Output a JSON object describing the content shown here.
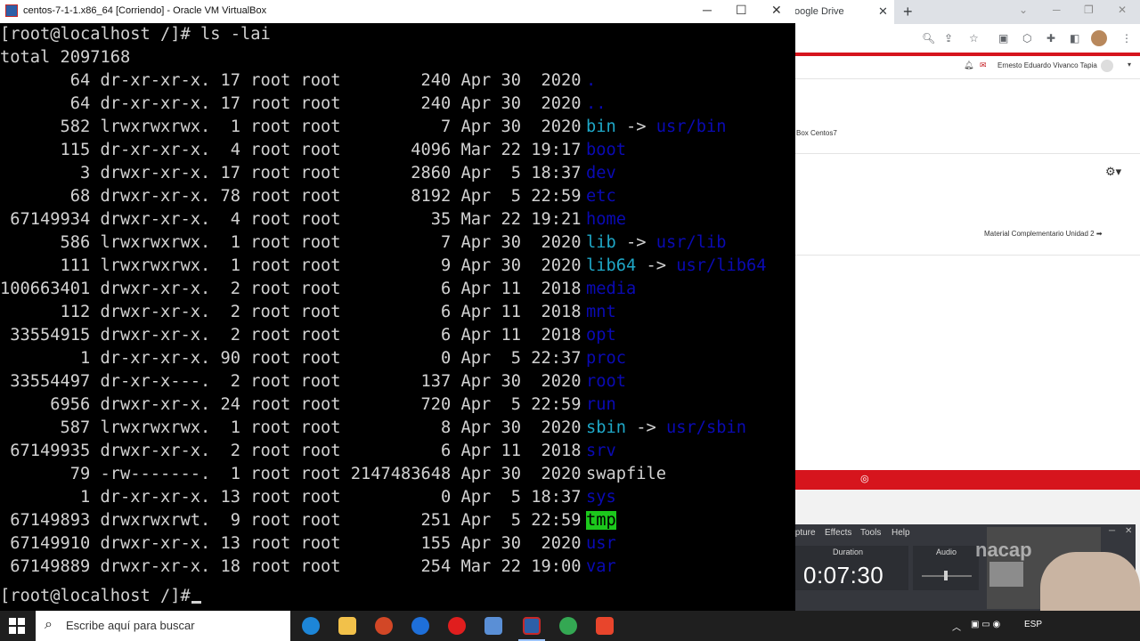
{
  "virtualbox": {
    "title": "centos-7-1-1.x86_64 [Corriendo] - Oracle VM VirtualBox",
    "minimize": "─",
    "maximize": "☐",
    "close": "✕"
  },
  "terminal": {
    "command_line": "[root@localhost /]# ls -lai",
    "total_line": "total 2097168",
    "rows": [
      {
        "text": "       64 dr-xr-xr-x. 17 root root        240 Apr 30  2020 ",
        "name": ".",
        "color": "#0a0ab4"
      },
      {
        "text": "       64 dr-xr-xr-x. 17 root root        240 Apr 30  2020 ",
        "name": "..",
        "color": "#0a0ab4"
      },
      {
        "text": "      582 lrwxrwxrwx.  1 root root          7 Apr 30  2020 ",
        "name": "bin",
        "link_arrow": " -> ",
        "link_target": "usr/bin",
        "color": "#1fa8c8",
        "target_color": "#0a0ab4"
      },
      {
        "text": "      115 dr-xr-xr-x.  4 root root       4096 Mar 22 19:17 ",
        "name": "boot",
        "color": "#0a0ab4"
      },
      {
        "text": "        3 drwxr-xr-x. 17 root root       2860 Apr  5 18:37 ",
        "name": "dev",
        "color": "#0a0ab4"
      },
      {
        "text": "       68 drwxr-xr-x. 78 root root       8192 Apr  5 22:59 ",
        "name": "etc",
        "color": "#0a0ab4"
      },
      {
        "text": " 67149934 drwxr-xr-x.  4 root root         35 Mar 22 19:21 ",
        "name": "home",
        "color": "#0a0ab4"
      },
      {
        "text": "      586 lrwxrwxrwx.  1 root root          7 Apr 30  2020 ",
        "name": "lib",
        "link_arrow": " -> ",
        "link_target": "usr/lib",
        "color": "#1fa8c8",
        "target_color": "#0a0ab4"
      },
      {
        "text": "      111 lrwxrwxrwx.  1 root root          9 Apr 30  2020 ",
        "name": "lib64",
        "link_arrow": " -> ",
        "link_target": "usr/lib64",
        "color": "#1fa8c8",
        "target_color": "#0a0ab4"
      },
      {
        "text": "100663401 drwxr-xr-x.  2 root root          6 Apr 11  2018 ",
        "name": "media",
        "color": "#0a0ab4"
      },
      {
        "text": "      112 drwxr-xr-x.  2 root root          6 Apr 11  2018 ",
        "name": "mnt",
        "color": "#0a0ab4"
      },
      {
        "text": " 33554915 drwxr-xr-x.  2 root root          6 Apr 11  2018 ",
        "name": "opt",
        "color": "#0a0ab4"
      },
      {
        "text": "        1 dr-xr-xr-x. 90 root root          0 Apr  5 22:37 ",
        "name": "proc",
        "color": "#0a0ab4"
      },
      {
        "text": " 33554497 dr-xr-x---.  2 root root        137 Apr 30  2020 ",
        "name": "root",
        "color": "#0a0ab4"
      },
      {
        "text": "     6956 drwxr-xr-x. 24 root root        720 Apr  5 22:59 ",
        "name": "run",
        "color": "#0a0ab4"
      },
      {
        "text": "      587 lrwxrwxrwx.  1 root root          8 Apr 30  2020 ",
        "name": "sbin",
        "link_arrow": " -> ",
        "link_target": "usr/sbin",
        "color": "#1fa8c8",
        "target_color": "#0a0ab4"
      },
      {
        "text": " 67149935 drwxr-xr-x.  2 root root          6 Apr 11  2018 ",
        "name": "srv",
        "color": "#0a0ab4"
      },
      {
        "text": "       79 -rw-------.  1 root root 2147483648 Apr 30  2020 ",
        "name": "swapfile",
        "color": "#d2d2d2"
      },
      {
        "text": "        1 dr-xr-xr-x. 13 root root          0 Apr  5 18:37 ",
        "name": "sys",
        "color": "#0a0ab4"
      },
      {
        "text": " 67149893 drwxrwxrwt.  9 root root        251 Apr  5 22:59 ",
        "name": "tmp",
        "color": "#000000",
        "bg": "#1cc81c"
      },
      {
        "text": " 67149910 drwxr-xr-x. 13 root root        155 Apr 30  2020 ",
        "name": "usr",
        "color": "#0a0ab4"
      },
      {
        "text": " 67149889 drwxr-xr-x. 18 root root        254 Mar 22 19:00 ",
        "name": "var",
        "color": "#0a0ab4"
      }
    ],
    "prompt": "[root@localhost /]#"
  },
  "browser": {
    "tab_title": "oogle Drive",
    "tab_close": "✕",
    "new_tab": "+",
    "user_name": "Ernesto Eduardo Vivanco Tapia",
    "course_text": "Box Centos7",
    "material_link": "Material Complementario Unidad 2 ➡"
  },
  "recorder": {
    "menu": [
      "Capture",
      "Effects",
      "Tools",
      "Help"
    ],
    "duration_label": "Duration",
    "duration_value": "0:07:30",
    "audio_label": "Audio",
    "brand": "nacap",
    "audio_level": 0.45
  },
  "taskbar": {
    "search_placeholder": "Escribe aquí para buscar",
    "language": "ESP"
  },
  "colors": {
    "terminal_bg": "#000000",
    "terminal_fg": "#d2d2d2",
    "dir_blue": "#0a0ab4",
    "link_cyan": "#1fa8c8",
    "tmp_green": "#1cc81c",
    "inacap_red": "#d6151d",
    "taskbar": "#1f1f1f"
  }
}
